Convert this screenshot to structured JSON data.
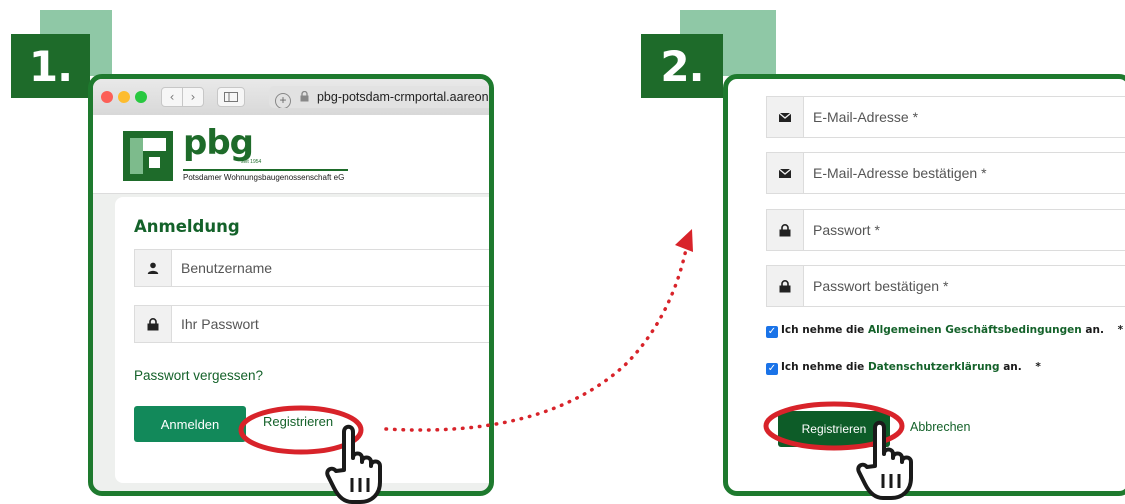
{
  "steps": {
    "step1": "1.",
    "step2": "2."
  },
  "browser": {
    "url": "pbg-potsdam-crmportal.aareon.co"
  },
  "logo": {
    "name": "pbg",
    "since": "seit 1954",
    "tagline": "Potsdamer Wohnungsbaugenossenschaft eG"
  },
  "login": {
    "title": "Anmeldung",
    "username_placeholder": "Benutzername",
    "password_placeholder": "Ihr Passwort",
    "forgot_password": "Passwort vergessen?",
    "login_button": "Anmelden",
    "register_link": "Registrieren"
  },
  "register": {
    "email_placeholder": "E-Mail-Adresse *",
    "email_confirm_placeholder": "E-Mail-Adresse bestätigen *",
    "password_placeholder": "Passwort *",
    "password_confirm_placeholder": "Passwort bestätigen *",
    "terms_prefix": "Ich nehme die ",
    "terms_link": "Allgemeinen Geschäftsbedingungen",
    "terms_suffix": " an.",
    "privacy_prefix": "Ich nehme die ",
    "privacy_link": "Datenschutzerklärung",
    "privacy_suffix": " an.",
    "required_mark": "*",
    "register_button": "Registrieren",
    "cancel_link": "Abbrechen"
  },
  "icons": {
    "user": "user-icon",
    "lock": "lock-icon",
    "envelope": "envelope-icon",
    "hand": "hand-pointer-icon"
  },
  "colors": {
    "brand_green": "#1e7a2e",
    "badge_light": "#8fc8a6",
    "button_green": "#12895a",
    "highlight_red": "#d8232a",
    "checkbox_blue": "#1a73e8"
  }
}
